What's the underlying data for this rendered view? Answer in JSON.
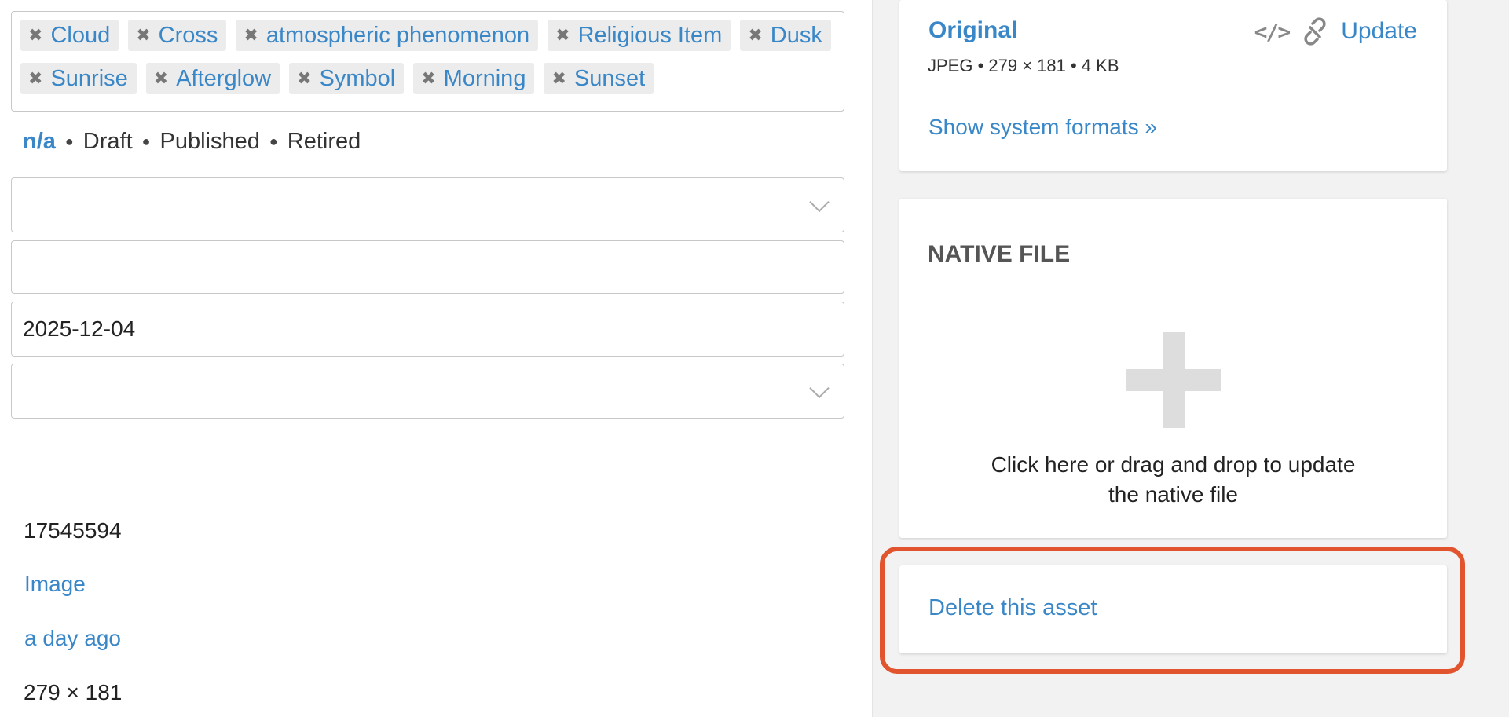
{
  "tags": [
    "Cloud",
    "Cross",
    "atmospheric phenomenon",
    "Religious Item",
    "Dusk",
    "Sunrise",
    "Afterglow",
    "Symbol",
    "Morning",
    "Sunset"
  ],
  "status": {
    "current": "n/a",
    "options": [
      "Draft",
      "Published",
      "Retired"
    ]
  },
  "fields": {
    "select1_value": "",
    "text1_value": "",
    "date_value": "2025-12-04",
    "select2_value": ""
  },
  "meta": {
    "id": "17545594",
    "type": "Image",
    "modified": "a day ago",
    "dimensions": "279 × 181"
  },
  "formats": {
    "original_label": "Original",
    "original_meta": "JPEG • 279 × 181 • 4 KB",
    "embed_icon": "</>",
    "update_label": "Update",
    "show_system": "Show system formats »"
  },
  "native_file": {
    "title": "NATIVE FILE",
    "help_line1": "Click here or drag and drop to update",
    "help_line2": "the native file"
  },
  "danger": {
    "delete_label": "Delete this asset"
  },
  "colors": {
    "accent": "#3a87c8",
    "highlight": "#e2542d"
  }
}
